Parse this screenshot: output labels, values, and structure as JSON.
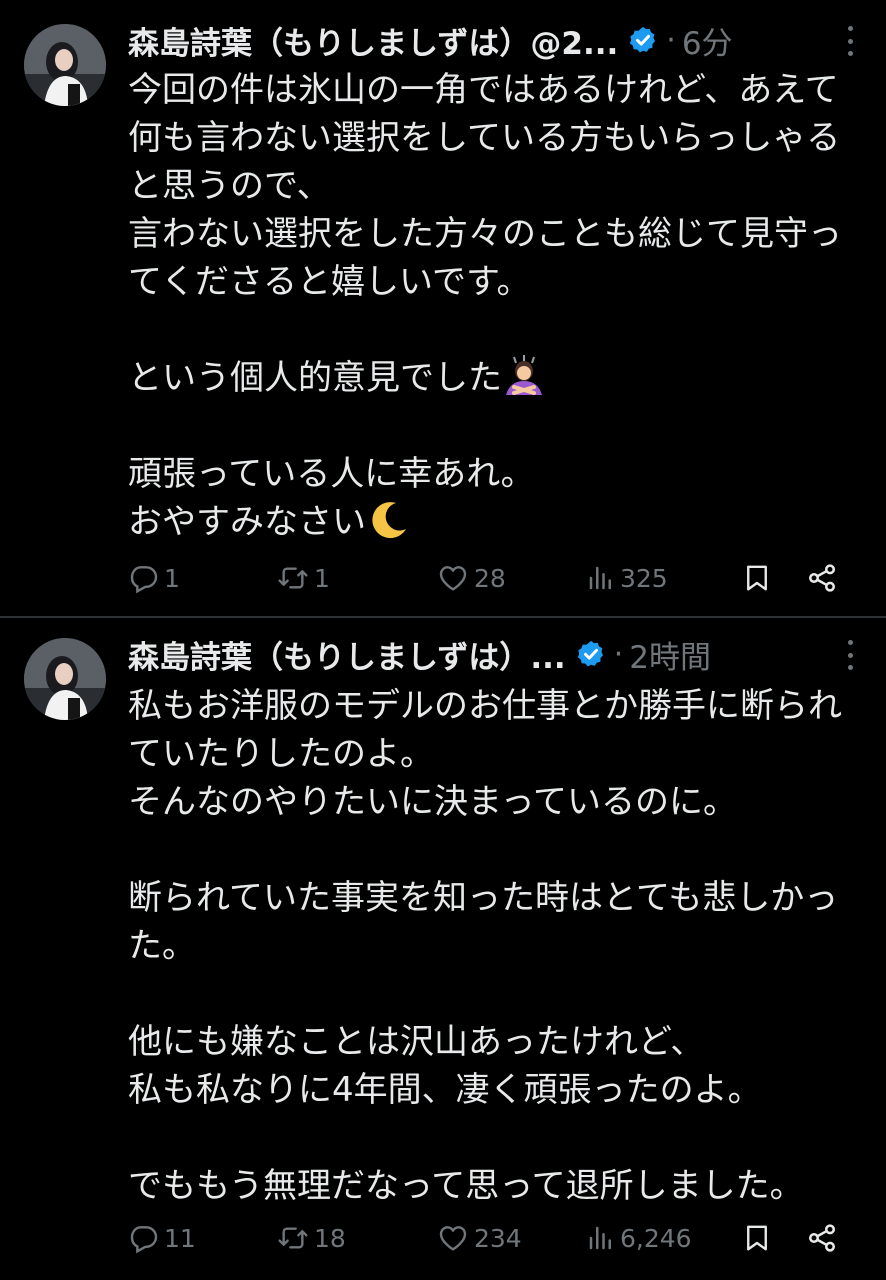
{
  "tweets": [
    {
      "author_name": "森島詩葉（もりしましずは）@2...",
      "separator": "·",
      "time": "6分",
      "text_before_emoji": "今回の件は氷山の一角ではあるけれど、あえて何も言わない選択をしている方もいらっしゃると思うので、\n言わない選択をした方々のことも総じて見守ってくださると嬉しいです。\n\nという個人的意見でした",
      "emoji_1": "person-gesturing-no-emoji",
      "text_middle": "\n\n頑張っている人に幸あれ。\nおやすみなさい",
      "emoji_2": "crescent-moon-emoji",
      "replies": "1",
      "retweets": "1",
      "likes": "28",
      "views": "325"
    },
    {
      "author_name": "森島詩葉（もりしましずは）...",
      "separator": "·",
      "time": "2時間",
      "text": "私もお洋服のモデルのお仕事とか勝手に断られていたりしたのよ。\nそんなのやりたいに決まっているのに。\n\n断られていた事実を知った時はとても悲しかった。\n\n他にも嫌なことは沢山あったけれど、\n私も私なりに4年間、凄く頑張ったのよ。\n\nでももう無理だなって思って退所しました。",
      "replies": "11",
      "retweets": "18",
      "likes": "234",
      "views": "6,246"
    }
  ],
  "colors": {
    "background": "#000000",
    "text": "#e7e9ea",
    "muted": "#71767b",
    "verified": "#1d9bf0",
    "divider": "#2f3336"
  }
}
